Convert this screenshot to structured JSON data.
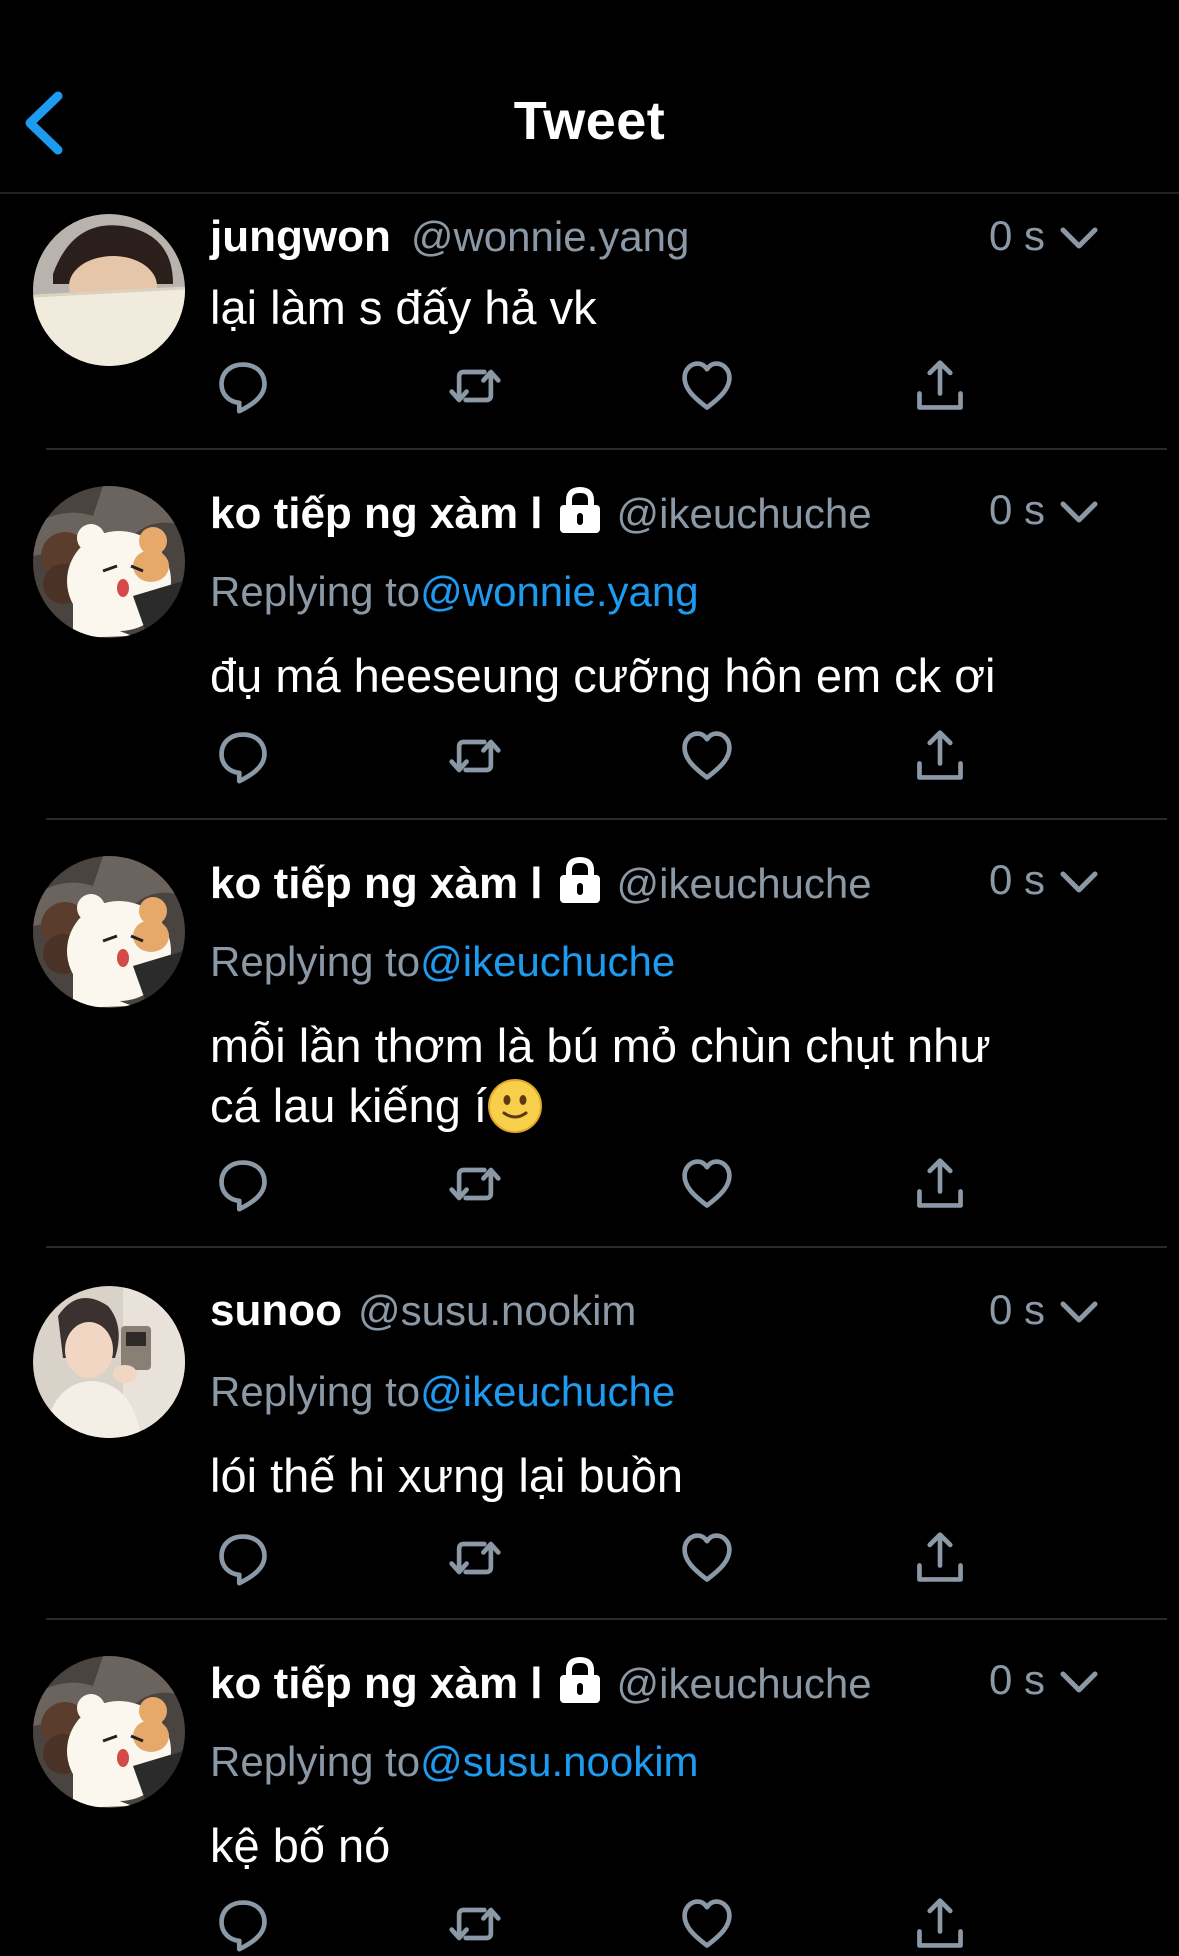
{
  "header": {
    "title": "Tweet"
  },
  "tweets": [
    {
      "name": "jungwon",
      "handle": "@wonnie.yang",
      "time": "0 s",
      "locked": false,
      "replying_label": "",
      "replying_handle": "",
      "text": "lại làm s đấy hả vk",
      "avatar": "person-paper"
    },
    {
      "name": "ko tiếp ng xàm l",
      "handle": "@ikeuchuche",
      "time": "0 s",
      "locked": true,
      "replying_label": "Replying to",
      "replying_handle": "@wonnie.yang",
      "text": "đụ má heeseung cưỡng hôn em ck ơi",
      "avatar": "bear"
    },
    {
      "name": "ko tiếp ng xàm l",
      "handle": "@ikeuchuche",
      "time": "0 s",
      "locked": true,
      "replying_label": "Replying to",
      "replying_handle": "@ikeuchuche",
      "text_line1": "mỗi lần thơm là bú mỏ chùn chụt như",
      "text_line2": "cá lau kiếng í",
      "emoji": "slightly-smiling-face",
      "avatar": "bear"
    },
    {
      "name": "sunoo",
      "handle": "@susu.nookim",
      "time": "0 s",
      "locked": false,
      "replying_label": "Replying to",
      "replying_handle": "@ikeuchuche",
      "text": "lói thế hi xưng lại buồn",
      "avatar": "person-phone"
    },
    {
      "name": "ko tiếp ng xàm l",
      "handle": "@ikeuchuche",
      "time": "0 s",
      "locked": true,
      "replying_label": "Replying to",
      "replying_handle": "@susu.nookim",
      "text": "kệ bố nó",
      "avatar": "bear"
    }
  ],
  "icons": {
    "back": "chevron-left-icon",
    "more": "chevron-down-icon",
    "lock": "lock-icon",
    "reply": "reply-icon",
    "retweet": "retweet-icon",
    "like": "heart-icon",
    "share": "share-icon"
  },
  "colors": {
    "background": "#000000",
    "accent": "#1d9bf0",
    "secondary_text": "#8b98a5",
    "divider": "#2a2a2a"
  }
}
